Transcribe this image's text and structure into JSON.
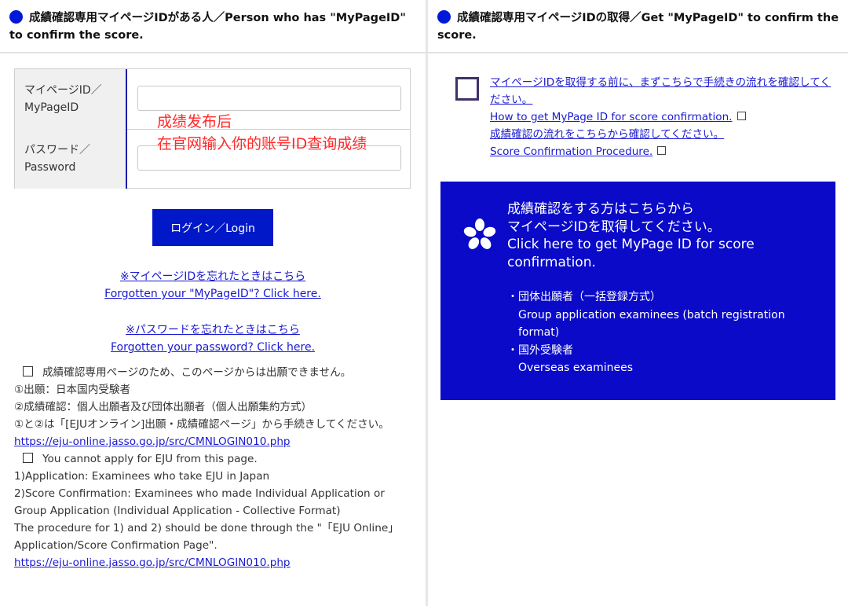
{
  "left": {
    "header": "成績確認専用マイページIDがある人／Person who has \"MyPageID\" to confirm the score.",
    "form": {
      "id_label_jp": "マイページID／",
      "id_label_en": "MyPageID",
      "id_value": "",
      "password_label_jp": "パスワード／",
      "password_label_en": "Password",
      "password_value": ""
    },
    "annotation_line1": "成绩发布后",
    "annotation_line2": "在官网输入你的账号ID查询成绩",
    "login_button": "ログイン／Login",
    "forgot_id_jp": "※マイページIDを忘れたときはこちら",
    "forgot_id_en": "Forgotten your \"MyPageID\"? Click here.",
    "forgot_pw_jp": "※パスワードを忘れたときはこちら",
    "forgot_pw_en": "Forgotten your password? Click here.",
    "notes": {
      "jp_intro": "成績確認専用ページのため、このページからは出願できません。",
      "jp_1": "①出願：日本国内受験者",
      "jp_2": "②成績確認：個人出願者及び団体出願者（個人出願集約方式）",
      "jp_3": "①と②は「[EJUオンライン]出願・成績確認ページ」から手続きしてください。",
      "url_1": "https://eju-online.jasso.go.jp/src/CMNLOGIN010.php",
      "en_intro": "You cannot apply for EJU from this page.",
      "en_1": "1)Application: Examinees who take EJU in Japan",
      "en_2": "2)Score Confirmation: Examinees who made Individual Application or Group Application (Individual Application - Collective Format)",
      "en_3": "The procedure for 1) and 2) should be done through the \"「EJU Online」Application/Score Confirmation Page\".",
      "url_2": "https://eju-online.jasso.go.jp/src/CMNLOGIN010.php"
    }
  },
  "right": {
    "header": "成績確認専用マイページIDの取得／Get \"MyPageID\" to confirm the score.",
    "link_1": "マイページIDを取得する前に、まずこちらで手続きの流れを確認してください。",
    "link_2": "How to get MyPage ID for score confirmation.",
    "link_3": "成績確認の流れをこちらから確認してください。",
    "link_4": "Score Confirmation Procedure.",
    "banner": {
      "title_jp_1": "成績確認をする方はこちらから",
      "title_jp_2": "マイページIDを取得してください。",
      "title_en": "Click here to get MyPage ID for score confirmation.",
      "item_1_jp": "・団体出願者（一括登録方式）",
      "item_1_en": "Group application examinees (batch registration format)",
      "item_2_jp": "・国外受験者",
      "item_2_en": "Overseas examinees"
    }
  },
  "colors": {
    "accent_blue": "#0018d8",
    "banner_blue": "#0a0ac8",
    "link_blue": "#1a1ad0",
    "annotation_red": "#ff2a2a",
    "box_purple": "#3f3266"
  }
}
